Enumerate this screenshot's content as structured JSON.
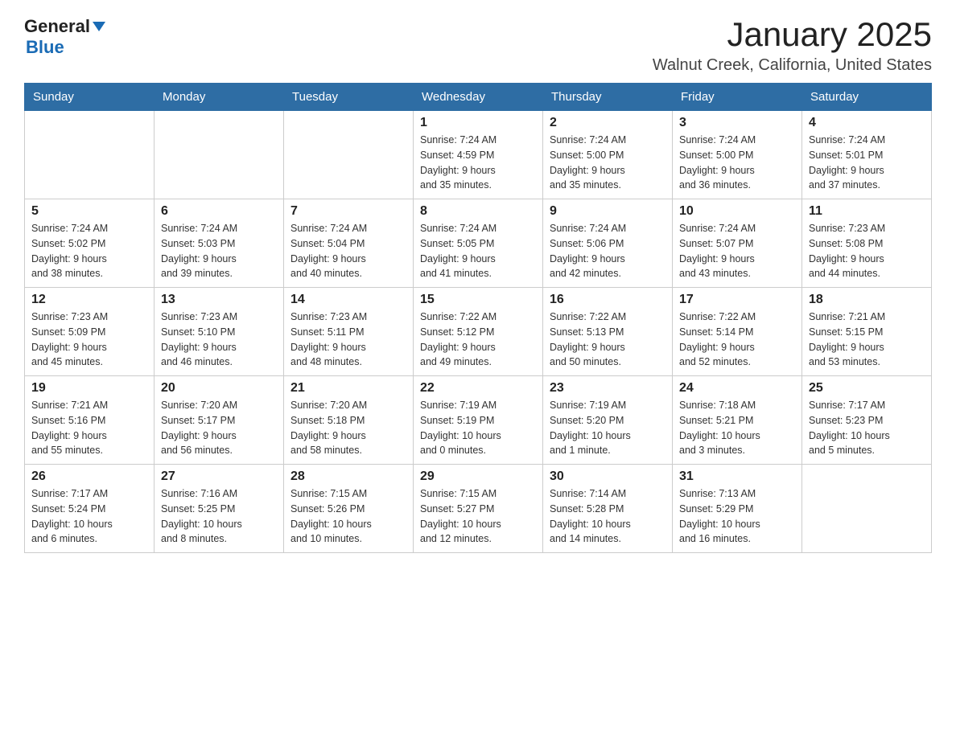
{
  "header": {
    "title": "January 2025",
    "subtitle": "Walnut Creek, California, United States",
    "logo": {
      "general": "General",
      "blue": "Blue"
    }
  },
  "weekdays": [
    "Sunday",
    "Monday",
    "Tuesday",
    "Wednesday",
    "Thursday",
    "Friday",
    "Saturday"
  ],
  "weeks": [
    [
      {
        "day": "",
        "info": ""
      },
      {
        "day": "",
        "info": ""
      },
      {
        "day": "",
        "info": ""
      },
      {
        "day": "1",
        "info": "Sunrise: 7:24 AM\nSunset: 4:59 PM\nDaylight: 9 hours\nand 35 minutes."
      },
      {
        "day": "2",
        "info": "Sunrise: 7:24 AM\nSunset: 5:00 PM\nDaylight: 9 hours\nand 35 minutes."
      },
      {
        "day": "3",
        "info": "Sunrise: 7:24 AM\nSunset: 5:00 PM\nDaylight: 9 hours\nand 36 minutes."
      },
      {
        "day": "4",
        "info": "Sunrise: 7:24 AM\nSunset: 5:01 PM\nDaylight: 9 hours\nand 37 minutes."
      }
    ],
    [
      {
        "day": "5",
        "info": "Sunrise: 7:24 AM\nSunset: 5:02 PM\nDaylight: 9 hours\nand 38 minutes."
      },
      {
        "day": "6",
        "info": "Sunrise: 7:24 AM\nSunset: 5:03 PM\nDaylight: 9 hours\nand 39 minutes."
      },
      {
        "day": "7",
        "info": "Sunrise: 7:24 AM\nSunset: 5:04 PM\nDaylight: 9 hours\nand 40 minutes."
      },
      {
        "day": "8",
        "info": "Sunrise: 7:24 AM\nSunset: 5:05 PM\nDaylight: 9 hours\nand 41 minutes."
      },
      {
        "day": "9",
        "info": "Sunrise: 7:24 AM\nSunset: 5:06 PM\nDaylight: 9 hours\nand 42 minutes."
      },
      {
        "day": "10",
        "info": "Sunrise: 7:24 AM\nSunset: 5:07 PM\nDaylight: 9 hours\nand 43 minutes."
      },
      {
        "day": "11",
        "info": "Sunrise: 7:23 AM\nSunset: 5:08 PM\nDaylight: 9 hours\nand 44 minutes."
      }
    ],
    [
      {
        "day": "12",
        "info": "Sunrise: 7:23 AM\nSunset: 5:09 PM\nDaylight: 9 hours\nand 45 minutes."
      },
      {
        "day": "13",
        "info": "Sunrise: 7:23 AM\nSunset: 5:10 PM\nDaylight: 9 hours\nand 46 minutes."
      },
      {
        "day": "14",
        "info": "Sunrise: 7:23 AM\nSunset: 5:11 PM\nDaylight: 9 hours\nand 48 minutes."
      },
      {
        "day": "15",
        "info": "Sunrise: 7:22 AM\nSunset: 5:12 PM\nDaylight: 9 hours\nand 49 minutes."
      },
      {
        "day": "16",
        "info": "Sunrise: 7:22 AM\nSunset: 5:13 PM\nDaylight: 9 hours\nand 50 minutes."
      },
      {
        "day": "17",
        "info": "Sunrise: 7:22 AM\nSunset: 5:14 PM\nDaylight: 9 hours\nand 52 minutes."
      },
      {
        "day": "18",
        "info": "Sunrise: 7:21 AM\nSunset: 5:15 PM\nDaylight: 9 hours\nand 53 minutes."
      }
    ],
    [
      {
        "day": "19",
        "info": "Sunrise: 7:21 AM\nSunset: 5:16 PM\nDaylight: 9 hours\nand 55 minutes."
      },
      {
        "day": "20",
        "info": "Sunrise: 7:20 AM\nSunset: 5:17 PM\nDaylight: 9 hours\nand 56 minutes."
      },
      {
        "day": "21",
        "info": "Sunrise: 7:20 AM\nSunset: 5:18 PM\nDaylight: 9 hours\nand 58 minutes."
      },
      {
        "day": "22",
        "info": "Sunrise: 7:19 AM\nSunset: 5:19 PM\nDaylight: 10 hours\nand 0 minutes."
      },
      {
        "day": "23",
        "info": "Sunrise: 7:19 AM\nSunset: 5:20 PM\nDaylight: 10 hours\nand 1 minute."
      },
      {
        "day": "24",
        "info": "Sunrise: 7:18 AM\nSunset: 5:21 PM\nDaylight: 10 hours\nand 3 minutes."
      },
      {
        "day": "25",
        "info": "Sunrise: 7:17 AM\nSunset: 5:23 PM\nDaylight: 10 hours\nand 5 minutes."
      }
    ],
    [
      {
        "day": "26",
        "info": "Sunrise: 7:17 AM\nSunset: 5:24 PM\nDaylight: 10 hours\nand 6 minutes."
      },
      {
        "day": "27",
        "info": "Sunrise: 7:16 AM\nSunset: 5:25 PM\nDaylight: 10 hours\nand 8 minutes."
      },
      {
        "day": "28",
        "info": "Sunrise: 7:15 AM\nSunset: 5:26 PM\nDaylight: 10 hours\nand 10 minutes."
      },
      {
        "day": "29",
        "info": "Sunrise: 7:15 AM\nSunset: 5:27 PM\nDaylight: 10 hours\nand 12 minutes."
      },
      {
        "day": "30",
        "info": "Sunrise: 7:14 AM\nSunset: 5:28 PM\nDaylight: 10 hours\nand 14 minutes."
      },
      {
        "day": "31",
        "info": "Sunrise: 7:13 AM\nSunset: 5:29 PM\nDaylight: 10 hours\nand 16 minutes."
      },
      {
        "day": "",
        "info": ""
      }
    ]
  ]
}
